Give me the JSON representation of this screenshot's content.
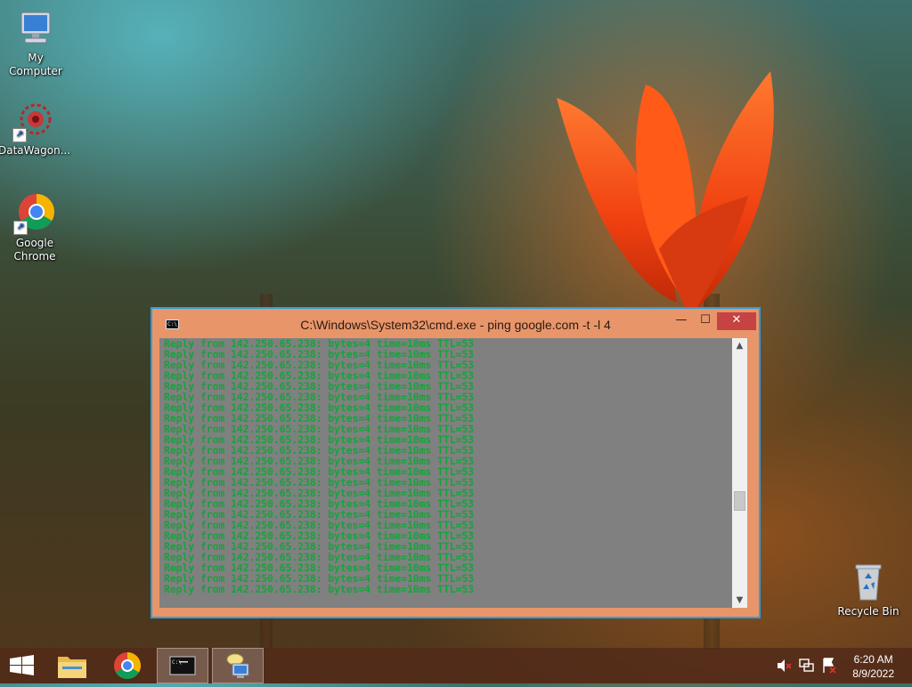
{
  "desktop": {
    "icons": [
      {
        "label": "My Computer"
      },
      {
        "label": "DataWagon..."
      },
      {
        "label": "Google Chrome"
      },
      {
        "label": "Recycle Bin"
      }
    ]
  },
  "window": {
    "title": "C:\\Windows\\System32\\cmd.exe - ping  google.com -t -l 4",
    "title_icon_text": "C:\\_",
    "minimize_glyph": "—",
    "maximize_glyph": "☐",
    "close_glyph": "✕",
    "console_lines": [
      "Reply from 142.250.65.238: bytes=4 time=10ms TTL=53",
      "Reply from 142.250.65.238: bytes=4 time=10ms TTL=53",
      "Reply from 142.250.65.238: bytes=4 time=10ms TTL=53",
      "Reply from 142.250.65.238: bytes=4 time=10ms TTL=53",
      "Reply from 142.250.65.238: bytes=4 time=10ms TTL=53",
      "Reply from 142.250.65.238: bytes=4 time=10ms TTL=53",
      "Reply from 142.250.65.238: bytes=4 time=10ms TTL=53",
      "Reply from 142.250.65.238: bytes=4 time=10ms TTL=53",
      "Reply from 142.250.65.238: bytes=4 time=10ms TTL=53",
      "Reply from 142.250.65.238: bytes=4 time=10ms TTL=53",
      "Reply from 142.250.65.238: bytes=4 time=10ms TTL=53",
      "Reply from 142.250.65.238: bytes=4 time=10ms TTL=53",
      "Reply from 142.250.65.238: bytes=4 time=10ms TTL=53",
      "Reply from 142.250.65.238: bytes=4 time=10ms TTL=53",
      "Reply from 142.250.65.238: bytes=4 time=10ms TTL=53",
      "Reply from 142.250.65.238: bytes=4 time=10ms TTL=53",
      "Reply from 142.250.65.238: bytes=4 time=10ms TTL=53",
      "Reply from 142.250.65.238: bytes=4 time=10ms TTL=53",
      "Reply from 142.250.65.238: bytes=4 time=10ms TTL=53",
      "Reply from 142.250.65.238: bytes=4 time=10ms TTL=53",
      "Reply from 142.250.65.238: bytes=4 time=10ms TTL=53",
      "Reply from 142.250.65.238: bytes=4 time=10ms TTL=53",
      "Reply from 142.250.65.238: bytes=4 time=10ms TTL=53",
      "Reply from 142.250.65.238: bytes=4 time=10ms TTL=53"
    ],
    "colors": {
      "frame": "#e8956a",
      "border": "#2b9fe0",
      "console_bg": "#808080",
      "console_text": "#17a23c",
      "close": "#c74242"
    }
  },
  "taskbar": {
    "items": [
      {
        "name": "start-button",
        "icon": "windows-logo-icon"
      },
      {
        "name": "file-explorer",
        "icon": "folder-icon"
      },
      {
        "name": "google-chrome",
        "icon": "chrome-icon"
      },
      {
        "name": "command-prompt",
        "icon": "cmd-icon",
        "active": true
      },
      {
        "name": "network-tool",
        "icon": "network-computer-icon"
      }
    ],
    "tray_icons": [
      "volume-muted-icon",
      "network-icon",
      "action-center-icon"
    ],
    "clock": {
      "time": "6:20 AM",
      "date": "8/9/2022"
    }
  }
}
